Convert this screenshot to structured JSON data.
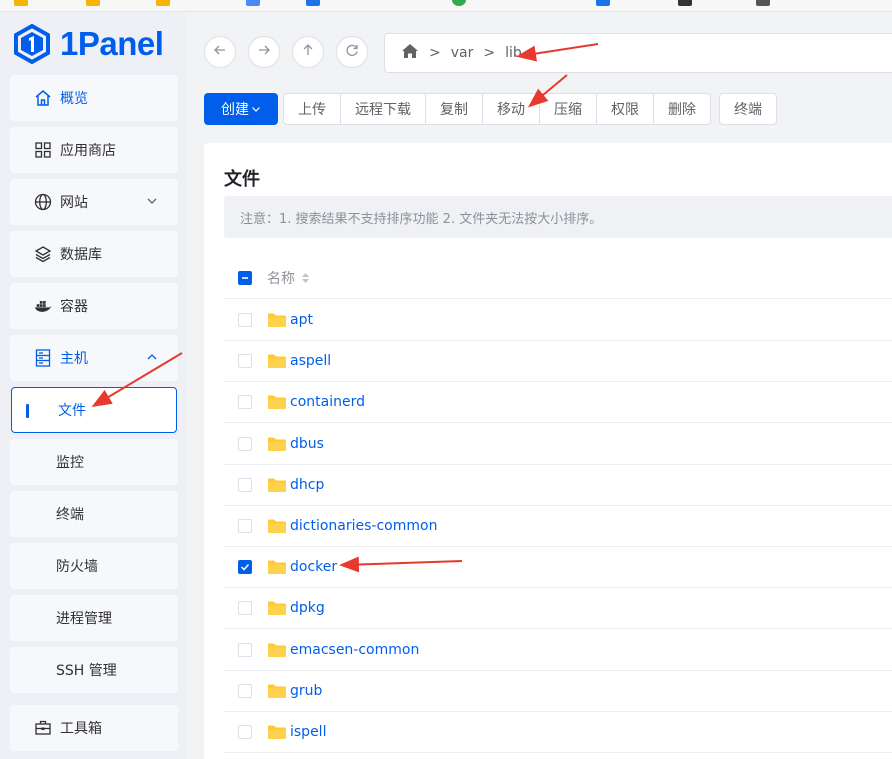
{
  "brand": {
    "name": "1Panel",
    "color": "#005eeb"
  },
  "sidebar": {
    "items": [
      {
        "label": "概览",
        "icon": "home-icon"
      },
      {
        "label": "应用商店",
        "icon": "grid-icon"
      },
      {
        "label": "网站",
        "icon": "globe-icon"
      },
      {
        "label": "数据库",
        "icon": "layers-icon"
      },
      {
        "label": "容器",
        "icon": "docker-icon"
      },
      {
        "label": "主机",
        "icon": "server-icon"
      }
    ],
    "host_subitems": [
      "文件",
      "监控",
      "终端",
      "防火墙",
      "进程管理",
      "SSH 管理"
    ],
    "selected_subitem": "文件",
    "tools": {
      "label": "工具箱",
      "icon": "toolbox-icon"
    }
  },
  "path": {
    "segments": [
      "var",
      "lib"
    ]
  },
  "toolbar": {
    "create_label": "创建",
    "group": [
      "上传",
      "远程下载",
      "复制",
      "移动",
      "压缩",
      "权限",
      "删除"
    ],
    "terminal_label": "终端"
  },
  "files": {
    "title": "文件",
    "notice": "注意：1. 搜索结果不支持排序功能 2. 文件夹无法按大小排序。",
    "column_name": "名称",
    "rows": [
      {
        "name": "apt",
        "checked": false
      },
      {
        "name": "aspell",
        "checked": false
      },
      {
        "name": "containerd",
        "checked": false
      },
      {
        "name": "dbus",
        "checked": false
      },
      {
        "name": "dhcp",
        "checked": false
      },
      {
        "name": "dictionaries-common",
        "checked": false
      },
      {
        "name": "docker",
        "checked": true
      },
      {
        "name": "dpkg",
        "checked": false
      },
      {
        "name": "emacsen-common",
        "checked": false
      },
      {
        "name": "grub",
        "checked": false
      },
      {
        "name": "ispell",
        "checked": false
      }
    ]
  },
  "colors": {
    "accent": "#005eeb",
    "annotation_arrow": "#e8392e",
    "folder": "#ffc933"
  }
}
